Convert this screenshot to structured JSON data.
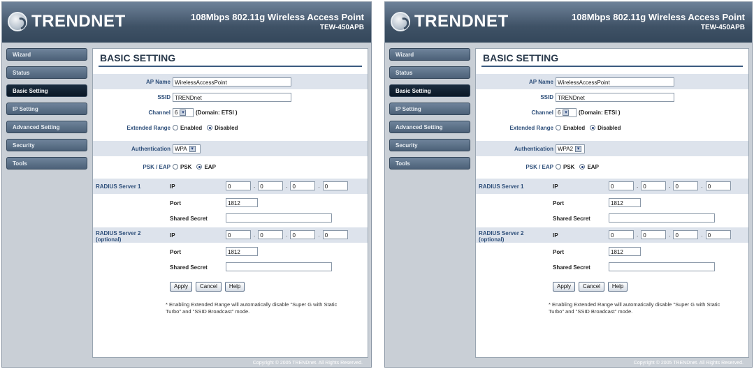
{
  "header": {
    "brand": "TRENDNET",
    "product_title": "108Mbps 802.11g Wireless Access Point",
    "model": "TEW-450APB"
  },
  "nav": {
    "items": [
      "Wizard",
      "Status",
      "Basic Setting",
      "IP Setting",
      "Advanced Setting",
      "Security",
      "Tools"
    ],
    "active": "Basic Setting"
  },
  "form": {
    "title": "BASIC SETTING",
    "ap_name_label": "AP Name",
    "ap_name_value": "WirelessAccessPoint",
    "ssid_label": "SSID",
    "ssid_value": "TRENDnet",
    "channel_label": "Channel",
    "channel_value": "6",
    "domain_text": "(Domain: ETSI )",
    "extended_range_label": "Extended Range",
    "enabled_label": "Enabled",
    "disabled_label": "Disabled",
    "auth_label": "Authentication",
    "psk_eap_label": "PSK / EAP",
    "psk_label": "PSK",
    "eap_label": "EAP",
    "radius1_label": "RADIUS Server 1",
    "radius2_label": "RADIUS Server 2 (optional)",
    "ip_label": "IP",
    "ip_octet": "0",
    "port_label": "Port",
    "port_value": "1812",
    "shared_secret_label": "Shared Secret",
    "apply": "Apply",
    "cancel": "Cancel",
    "help": "Help",
    "note": "* Enabling Extended Range will automatically disable \"Super G with Static Turbo\" and \"SSID Broadcast\" mode."
  },
  "panels": {
    "left": {
      "auth_value": "WPA"
    },
    "right": {
      "auth_value": "WPA2"
    }
  },
  "footer": "Copyright © 2005 TRENDnet. All Rights Reserved."
}
